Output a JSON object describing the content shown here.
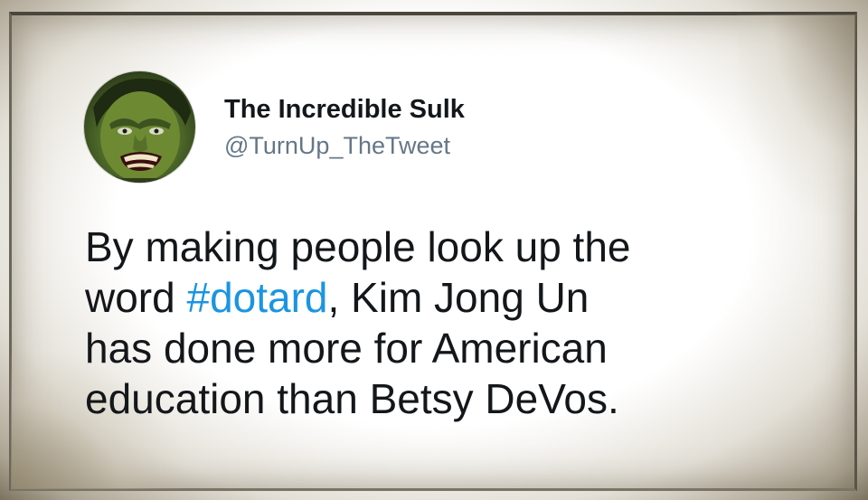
{
  "tweet": {
    "display_name": "The Incredible Sulk",
    "handle": "@TurnUp_TheTweet",
    "lines": {
      "l1": "By making people look up the",
      "l2_before": "word ",
      "l2_hashtag": "#dotard",
      "l2_after": ", Kim Jong Un",
      "l3": "has done more for American",
      "l4": "education than Betsy DeVos."
    },
    "avatar_icon": "hulk-face-avatar"
  },
  "colors": {
    "text": "#14171a",
    "handle": "#657786",
    "hashtag": "#1b95e0"
  }
}
